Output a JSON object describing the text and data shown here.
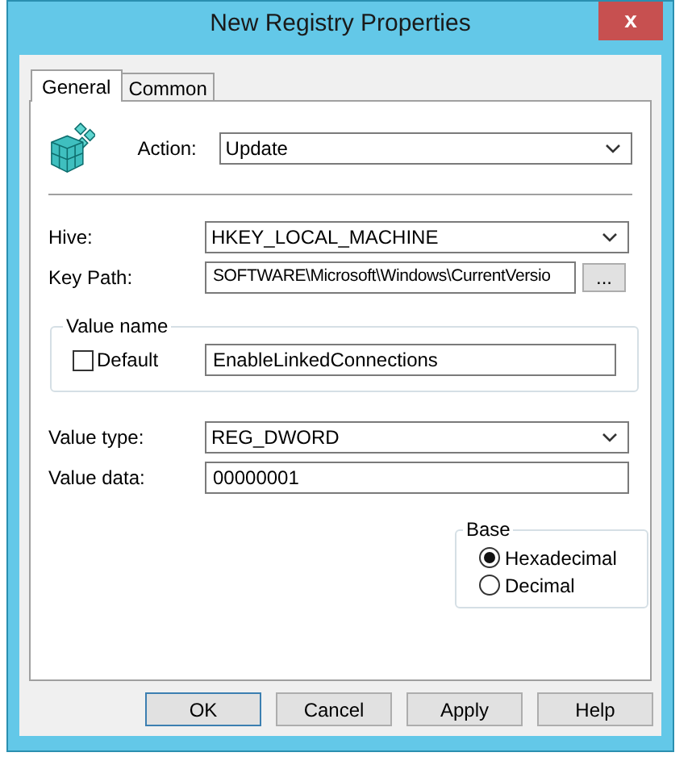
{
  "window": {
    "title": "New Registry Properties",
    "close": "x"
  },
  "tabs": [
    {
      "label": "General",
      "selected": true
    },
    {
      "label": "Common",
      "selected": false
    }
  ],
  "action": {
    "label": "Action:",
    "value": "Update"
  },
  "hive": {
    "label": "Hive:",
    "value": "HKEY_LOCAL_MACHINE"
  },
  "key_path": {
    "label": "Key Path:",
    "value": "SOFTWARE\\Microsoft\\Windows\\CurrentVersio",
    "browse": "..."
  },
  "value_name": {
    "title": "Value name",
    "default_label": "Default",
    "default_checked": false,
    "value": "EnableLinkedConnections"
  },
  "value_type": {
    "label": "Value type:",
    "value": "REG_DWORD"
  },
  "value_data": {
    "label": "Value data:",
    "value": "00000001"
  },
  "base": {
    "title": "Base",
    "options": [
      {
        "label": "Hexadecimal",
        "selected": true
      },
      {
        "label": "Decimal",
        "selected": false
      }
    ]
  },
  "buttons": [
    {
      "label": "OK",
      "default": true
    },
    {
      "label": "Cancel",
      "default": false
    },
    {
      "label": "Apply",
      "default": false
    },
    {
      "label": "Help",
      "default": false
    }
  ]
}
